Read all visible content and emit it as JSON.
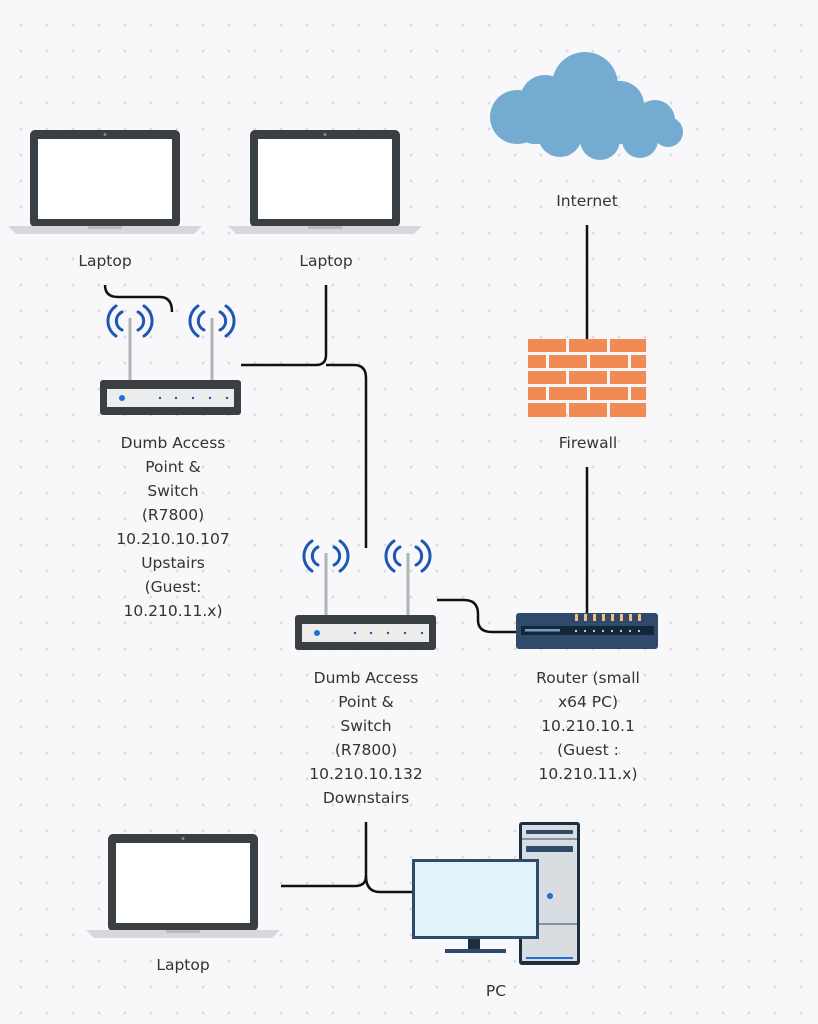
{
  "nodes": {
    "internet": {
      "label": "Internet",
      "icon": "cloud-icon",
      "color": "#73acd0"
    },
    "firewall": {
      "label": "Firewall",
      "icon": "brick-wall-icon",
      "color": "#f28a55"
    },
    "laptop_upstairs_1": {
      "label": "Laptop",
      "icon": "laptop-icon"
    },
    "laptop_upstairs_2": {
      "label": "Laptop",
      "icon": "laptop-icon"
    },
    "ap_upstairs": {
      "icon": "wireless-access-point-icon",
      "lines": [
        "Dumb Access",
        "Point &",
        "Switch",
        "(R7800)",
        "10.210.10.107",
        "Upstairs",
        "(Guest:",
        "10.210.11.x)"
      ]
    },
    "ap_downstairs": {
      "icon": "wireless-access-point-icon",
      "lines": [
        "Dumb Access",
        "Point  &",
        "Switch",
        "(R7800)",
        "10.210.10.132",
        "Downstairs"
      ]
    },
    "router": {
      "icon": "router-icon",
      "color": "#2f4a6a",
      "lines": [
        "Router (small",
        "x64 PC)",
        "10.210.10.1",
        "(Guest :",
        "10.210.11.x)"
      ]
    },
    "laptop_downstairs": {
      "label": "Laptop",
      "icon": "laptop-icon"
    },
    "pc": {
      "label": "PC",
      "icon": "desktop-pc-icon"
    }
  },
  "colors": {
    "antenna_waves": "#1e56b4",
    "device_body": "#3a3f44",
    "screen": "#ffffff",
    "monitor_screen": "#e0f2fa"
  }
}
